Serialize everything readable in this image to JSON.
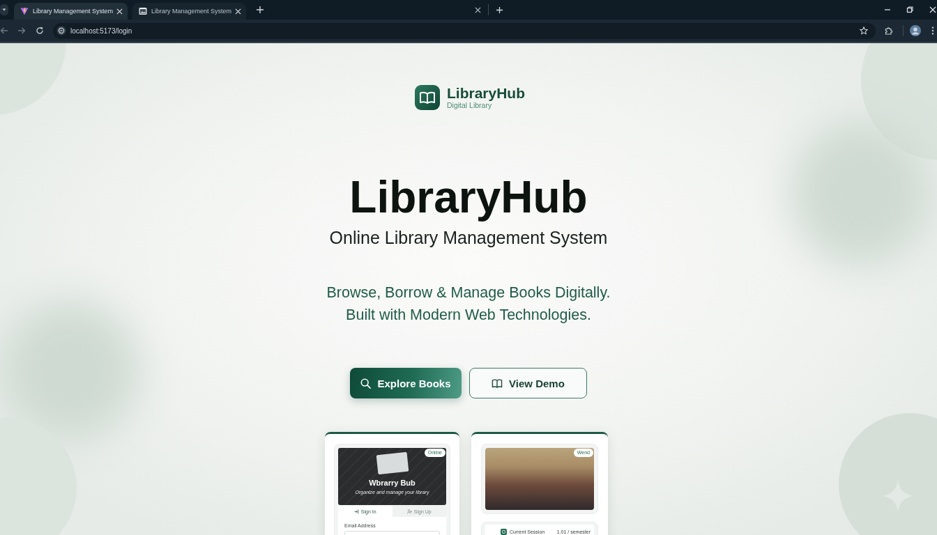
{
  "browser": {
    "tabs": [
      {
        "title": "Library Management System",
        "selected": true
      },
      {
        "title": "Library Management System",
        "selected": false
      }
    ],
    "address": "localhost:5173/login"
  },
  "brand": {
    "name": "LibraryHub",
    "tagline": "Digital Library"
  },
  "hero": {
    "title": "LibraryHub",
    "subtitle": "Online Library Management System",
    "description": [
      "Browse, Borrow & Manage Books Digitally.",
      "Built with Modern Web Technologies."
    ]
  },
  "actions": [
    {
      "label": "Explore Books",
      "kind": "primary"
    },
    {
      "label": "View Demo",
      "kind": "secondary"
    }
  ],
  "previews": [
    {
      "kind": "login",
      "badge": "Online",
      "banner_title": "Wbrarry Bub",
      "banner_subtitle": "Organize and manage your library",
      "tabs": [
        {
          "label": "Sign In",
          "selected": true
        },
        {
          "label": "Sign Up",
          "selected": false
        }
      ],
      "field_label": "Email Address"
    },
    {
      "kind": "catalog",
      "badge": "Wend",
      "status_label": "Current Session",
      "status_value": "1.01 / semester"
    }
  ]
}
